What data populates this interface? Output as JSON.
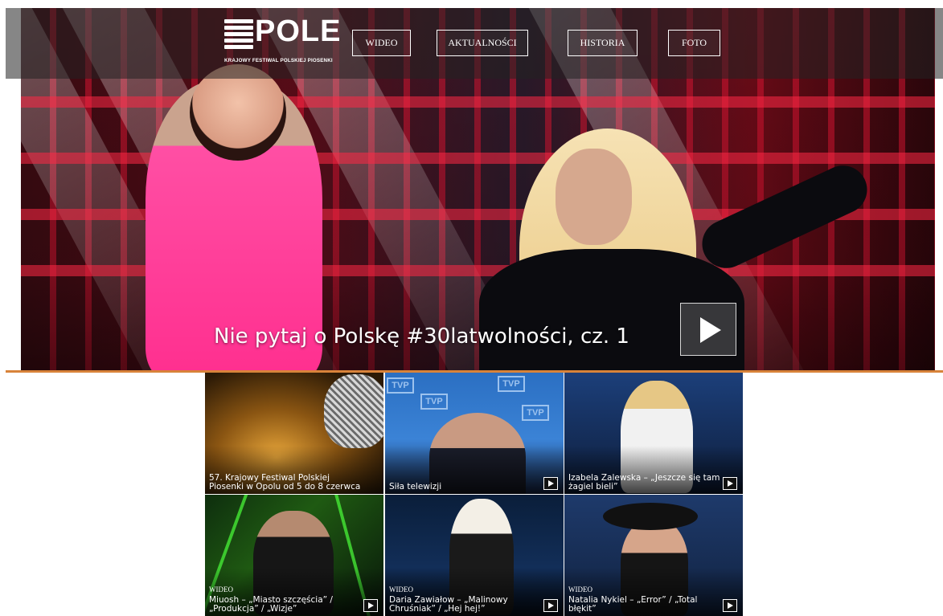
{
  "header": {
    "logo_word": "POLE",
    "logo_subtitle": "KRAJOWY FESTIWAL POLSKIEJ PIOSENKI",
    "nav": [
      {
        "label": "WIDEO"
      },
      {
        "label": "AKTUALNOŚCI"
      },
      {
        "label": "HISTORIA"
      },
      {
        "label": "FOTO"
      }
    ]
  },
  "hero": {
    "title": "Nie pytaj o Polskę #30latwolności, cz. 1",
    "play_icon": "play-icon"
  },
  "colors": {
    "divider": "#d8833a",
    "nav_border": "#ffffff"
  },
  "tiles": [
    {
      "caption": "57. Krajowy Festiwal Polskiej Piosenki w Opolu od 5 do 8 czerwca",
      "tag": "",
      "has_play": false
    },
    {
      "caption": "Siła telewizji",
      "tag": "",
      "has_play": true
    },
    {
      "caption": "Izabela Zalewska – „Jeszcze się tam żagiel bieli”",
      "tag": "",
      "has_play": true
    },
    {
      "caption": "Miuosh – „Miasto szczęścia” / „Produkcja” / „Wizje”",
      "tag": "WIDEO",
      "has_play": true
    },
    {
      "caption": "Daria Zawiałow – „Malinowy Chruśniak” / „Hej hej!”",
      "tag": "WIDEO",
      "has_play": true
    },
    {
      "caption": "Natalia Nykiel – „Error” / „Total błękit”",
      "tag": "WIDEO",
      "has_play": true
    }
  ],
  "tile_badges": {
    "tvp": "TVP"
  }
}
